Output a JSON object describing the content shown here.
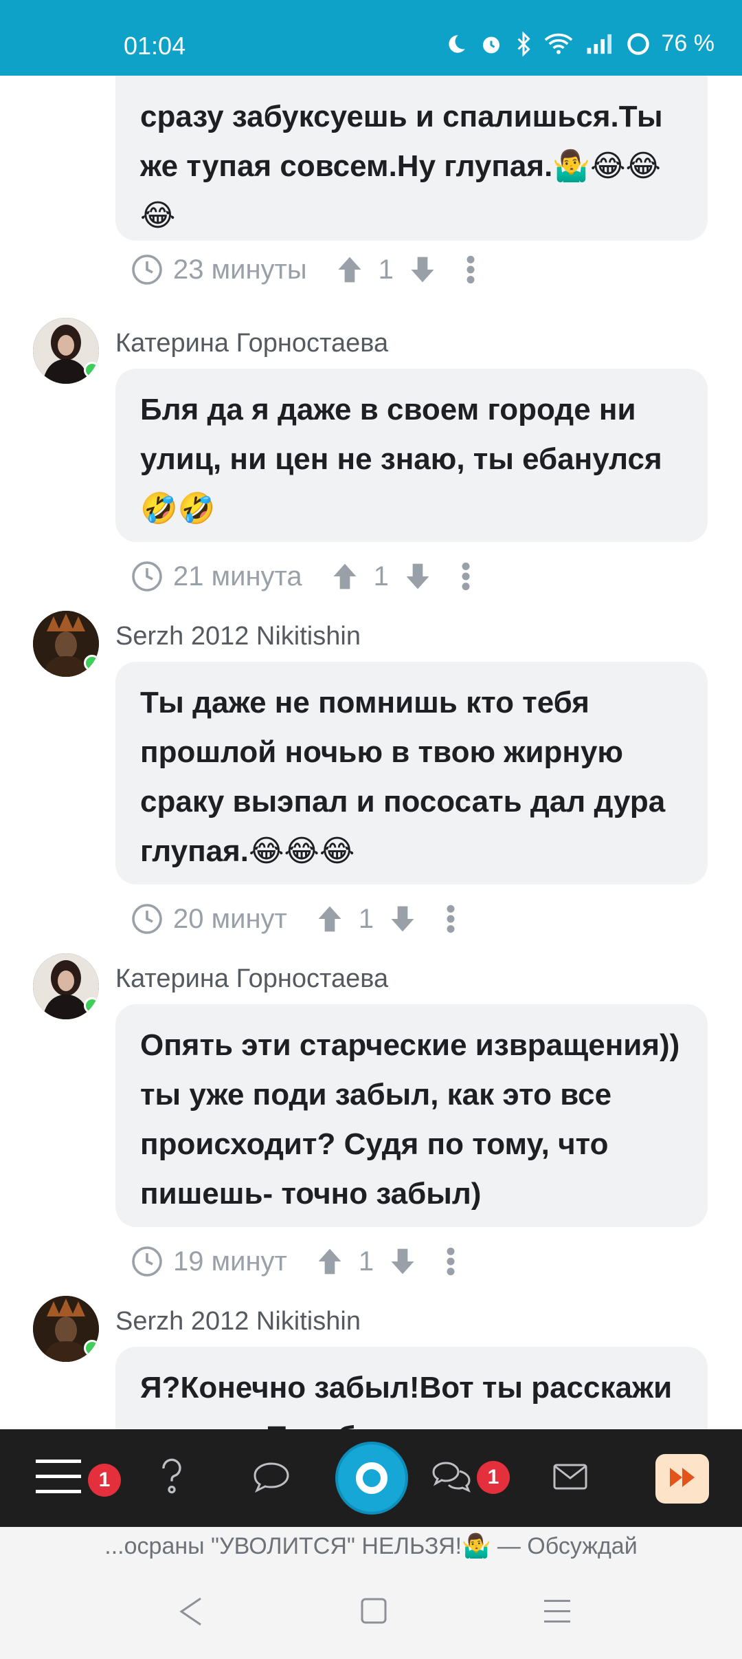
{
  "status_bar": {
    "time": "01:04",
    "battery": "76 %"
  },
  "comments": [
    {
      "author": "",
      "text": "сразу забуксуешь и спалишься.Ты же тупая совсем.Ну глупая.🤷‍♂️😂😂😂",
      "time": "23 минуты",
      "votes": "1"
    },
    {
      "author": "Катерина Горностаева",
      "text": "Бля да я даже в своем городе ни улиц, ни цен не знаю, ты ебанулся 🤣🤣",
      "time": "21 минута",
      "votes": "1"
    },
    {
      "author": "Serzh 2012 Nikitishin",
      "text": "Ты даже не помнишь кто тебя прошлой ночью в твою жирную сраку выэпал и пососать дал дура глупая.😂😂😂",
      "time": "20 минут",
      "votes": "1"
    },
    {
      "author": "Катерина Горностаева",
      "text": "Опять эти старческие извращения)) ты уже поди забыл, как это все происходит? Судя по тому, что пишешь- точно забыл)",
      "time": "19 минут",
      "votes": "1"
    },
    {
      "author": "Serzh 2012 Nikitishin",
      "text": "Я?Конечно забыл!Вот ты расскажи в лицах.Позабавь",
      "time": "",
      "votes": ""
    }
  ],
  "bottom_nav": {
    "menu_badge": "1",
    "messages_badge": "1"
  },
  "ticker": "...осраны \"УВОЛИТСЯ\" НЕЛЬЗЯ!🤷‍♂️ — Обсуждай",
  "icons": [
    "moon-icon",
    "alarm-icon",
    "bluetooth-icon",
    "wifi-icon",
    "signal-icon",
    "battery-icon",
    "clock-icon",
    "upvote-icon",
    "downvote-icon",
    "more-icon",
    "menu-icon",
    "question-icon",
    "chat-icon",
    "messages-icon",
    "mail-icon",
    "fast-forward-icon",
    "back-icon",
    "home-icon",
    "recents-icon"
  ],
  "colors": {
    "status_bar": "#0fa2c8",
    "nav_bg": "#1e1e1f",
    "badge": "#e4303c",
    "online": "#3ecf5a"
  }
}
